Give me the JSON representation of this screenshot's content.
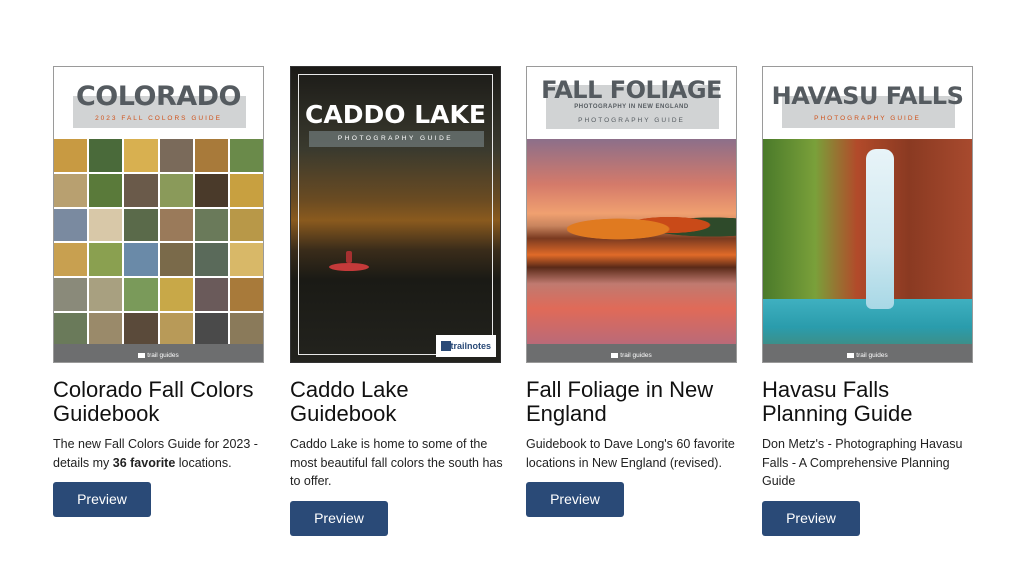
{
  "cards": [
    {
      "title": "Colorado Fall Colors Guidebook",
      "description_prefix": "The new Fall Colors Guide for 2023 - details my ",
      "description_bold": "36 favorite",
      "description_suffix": " locations.",
      "button_label": "Preview",
      "cover": {
        "title": "COLORADO",
        "subtitle": "2023 FALL COLORS GUIDE",
        "footer_logo": "trail guides",
        "accent_color": "#d0521a"
      }
    },
    {
      "title": "Caddo Lake Guidebook",
      "description": "Caddo Lake is home to some of the most beautiful fall colors the south has to offer.",
      "button_label": "Preview",
      "cover": {
        "title": "CADDO LAKE",
        "subtitle": "PHOTOGRAPHY GUIDE",
        "footer_logo": "trailnotes"
      }
    },
    {
      "title": "Fall Foliage in New England",
      "description": "Guidebook to Dave Long's 60 favorite locations in New England (revised).",
      "button_label": "Preview",
      "cover": {
        "title": "FALL FOLIAGE",
        "tagline": "PHOTOGRAPHY IN NEW ENGLAND",
        "subtitle": "PHOTOGRAPHY GUIDE",
        "footer_logo": "trail guides"
      }
    },
    {
      "title": "Havasu Falls Planning Guide",
      "description": "Don Metz's - Photographing Havasu Falls - A Comprehensive Planning Guide",
      "button_label": "Preview",
      "cover": {
        "title": "HAVASU FALLS",
        "subtitle": "PHOTOGRAPHY GUIDE",
        "footer_logo": "trail guides",
        "accent_color": "#d0521a"
      }
    }
  ],
  "colors": {
    "button_bg": "#2a4a77",
    "button_text": "#ffffff",
    "cover_footer": "#6d6e6f",
    "cover_band": "#d1d3d4"
  }
}
